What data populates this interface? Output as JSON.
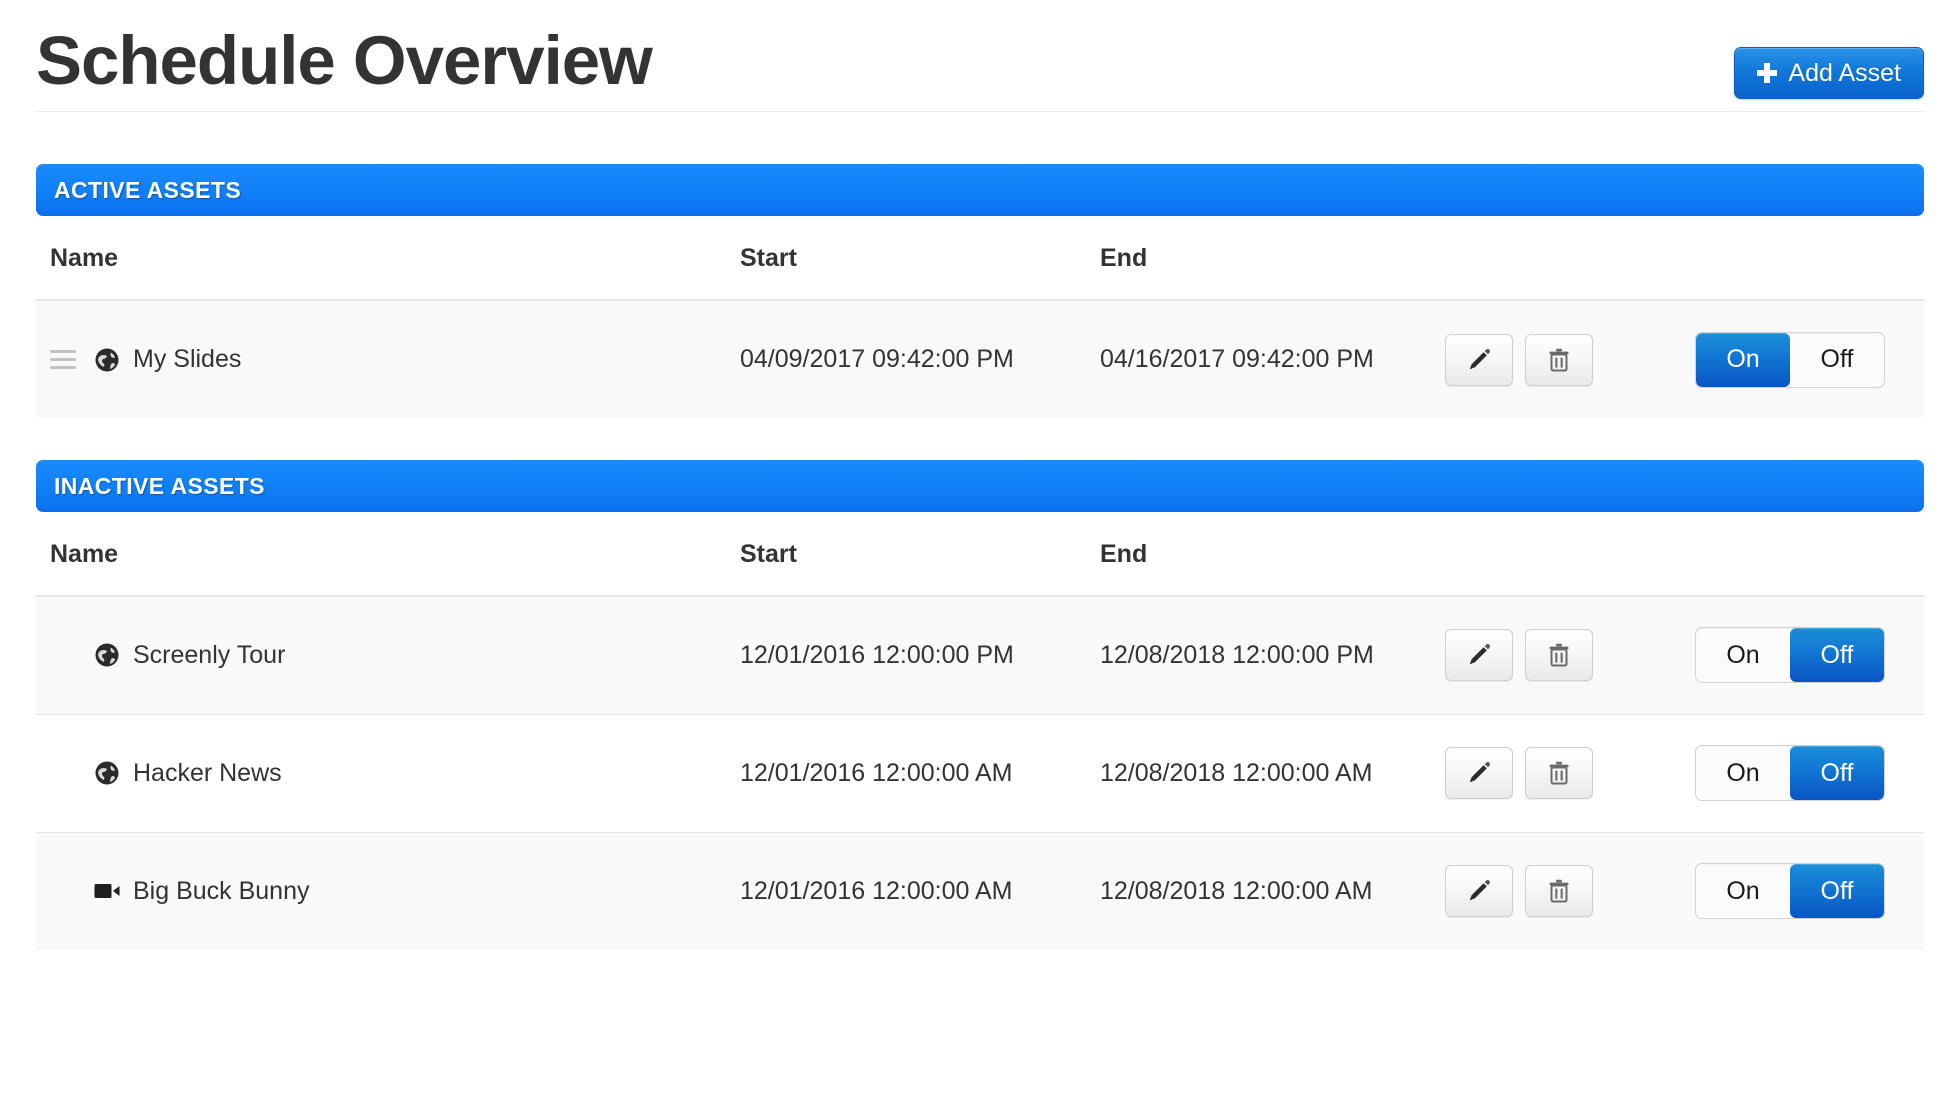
{
  "header": {
    "title": "Schedule Overview",
    "add_asset_label": "Add Asset",
    "add_icon": "plus-icon"
  },
  "colors": {
    "accent_blue": "#1180f7",
    "button_blue_top": "#2a93e8",
    "button_blue_bottom": "#0b63cc",
    "toggle_on_top": "#1b8fd8",
    "toggle_on_bottom": "#0a55c4",
    "row_stripe": "#f9f9f9",
    "text": "#333333",
    "border": "#e4e4e4"
  },
  "columns": {
    "name": "Name",
    "start": "Start",
    "end": "End"
  },
  "actions": {
    "edit_icon": "pencil-icon",
    "delete_icon": "trash-icon",
    "toggle_on_label": "On",
    "toggle_off_label": "Off"
  },
  "sections": [
    {
      "id": "active",
      "title": "ACTIVE ASSETS",
      "rows": [
        {
          "name": "My Slides",
          "icon": "globe-icon",
          "start": "04/09/2017 09:42:00 PM",
          "end": "04/16/2017 09:42:00 PM",
          "state": "on",
          "draggable": true
        }
      ]
    },
    {
      "id": "inactive",
      "title": "INACTIVE ASSETS",
      "rows": [
        {
          "name": "Screenly Tour",
          "icon": "globe-icon",
          "start": "12/01/2016 12:00:00 PM",
          "end": "12/08/2018 12:00:00 PM",
          "state": "off",
          "draggable": false
        },
        {
          "name": "Hacker News",
          "icon": "globe-icon",
          "start": "12/01/2016 12:00:00 AM",
          "end": "12/08/2018 12:00:00 AM",
          "state": "off",
          "draggable": false
        },
        {
          "name": "Big Buck Bunny",
          "icon": "video-icon",
          "start": "12/01/2016 12:00:00 AM",
          "end": "12/08/2018 12:00:00 AM",
          "state": "off",
          "draggable": false
        }
      ]
    }
  ]
}
